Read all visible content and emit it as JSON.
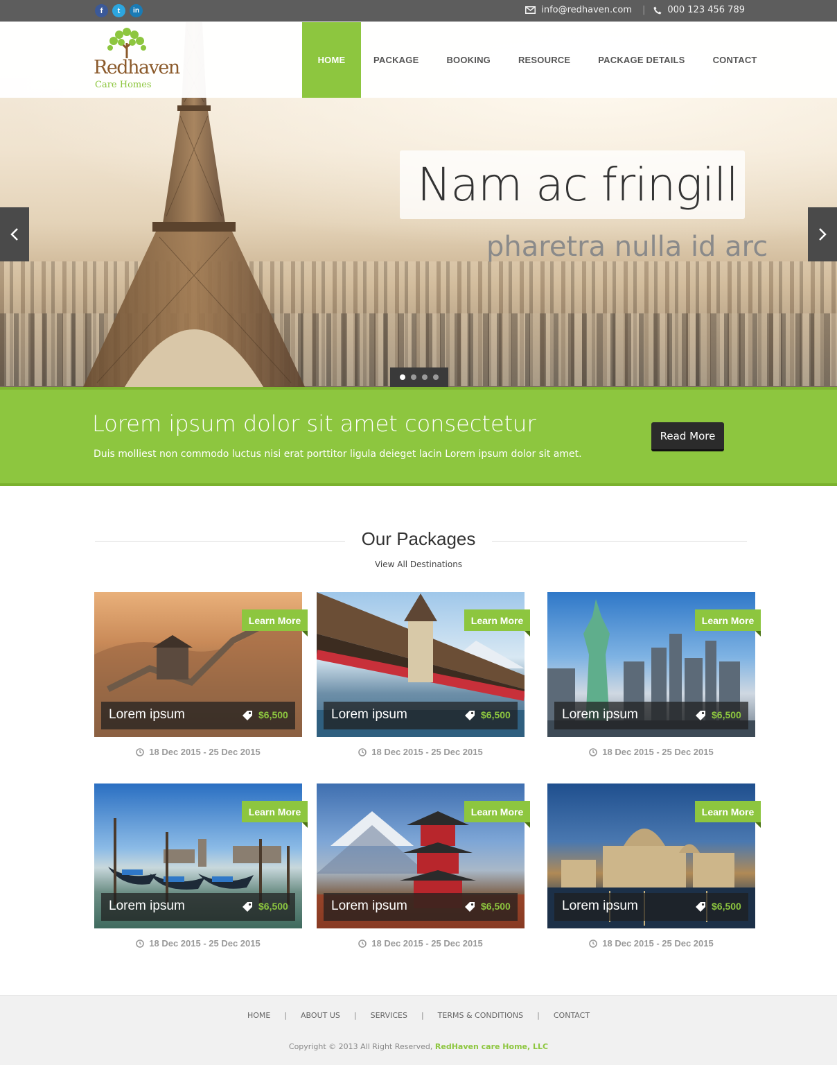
{
  "topbar": {
    "social": [
      {
        "icon": "facebook-icon",
        "glyph": "f"
      },
      {
        "icon": "twitter-icon",
        "glyph": "t"
      },
      {
        "icon": "linkedin-icon",
        "glyph": "in"
      }
    ],
    "email": "info@redhaven.com",
    "phone": "000 123 456 789"
  },
  "logo": {
    "name": "Redhaven",
    "sub": "Care Homes"
  },
  "nav": [
    "HOME",
    "PACKAGE",
    "BOOKING",
    "RESOURCE",
    "PACKAGE DETAILS",
    "CONTACT"
  ],
  "hero": {
    "title": "Nam ac fringill",
    "subtitle": "pharetra nulla id arc",
    "slides_total": 4,
    "active_slide": 1
  },
  "band": {
    "title": "Lorem ipsum dolor sit amet consectetur",
    "text": "Duis molliest non commodo luctus nisi erat porttitor ligula deieget lacin Lorem ipsum dolor sit amet.",
    "button": "Read More"
  },
  "packages": {
    "title": "Our Packages",
    "link": "View All Destinations",
    "items": [
      {
        "title": "Lorem ipsum",
        "price": "$6,500",
        "dates": "18 Dec 2015 - 25 Dec 2015",
        "learn": "Learn More"
      },
      {
        "title": "Lorem ipsum",
        "price": "$6,500",
        "dates": "18 Dec 2015 - 25 Dec 2015",
        "learn": "Learn More"
      },
      {
        "title": "Lorem ipsum",
        "price": "$6,500",
        "dates": "18 Dec 2015 - 25 Dec 2015",
        "learn": "Learn More"
      },
      {
        "title": "Lorem ipsum",
        "price": "$6,500",
        "dates": "18 Dec 2015 - 25 Dec 2015",
        "learn": "Learn More"
      },
      {
        "title": "Lorem ipsum",
        "price": "$6,500",
        "dates": "18 Dec 2015 - 25 Dec 2015",
        "learn": "Learn More"
      },
      {
        "title": "Lorem ipsum",
        "price": "$6,500",
        "dates": "18 Dec 2015 - 25 Dec 2015",
        "learn": "Learn More"
      }
    ]
  },
  "footer": {
    "links": [
      "HOME",
      "ABOUT US",
      "SERVICES",
      "TERMS & CONDITIONS",
      "CONTACT"
    ],
    "copyright": "Copyright © 2013 All Right Reserved,",
    "company": "RedHaven care Home, LLC"
  },
  "colors": {
    "accent": "#8dc63f",
    "topbar": "#5d5d5d",
    "dark": "#2b2b2b"
  }
}
